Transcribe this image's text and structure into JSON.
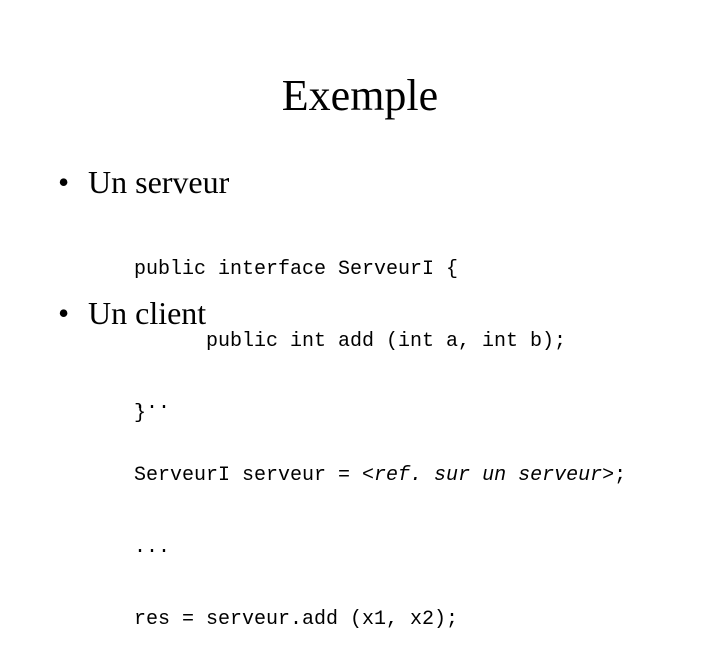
{
  "slide": {
    "title": "Exemple",
    "bullet_icon": "•",
    "sections": [
      {
        "heading": "Un serveur",
        "code_lines": [
          "public interface ServeurI {",
          "public int add (int a, int b);",
          "}"
        ]
      },
      {
        "heading": "Un client",
        "code_lines": [
          "...",
          "ServeurI serveur = ",
          "...",
          "res = serveur.add (x1, x2);"
        ],
        "placeholder": "<ref. sur un serveur>",
        "placeholder_suffix": ";"
      }
    ]
  }
}
